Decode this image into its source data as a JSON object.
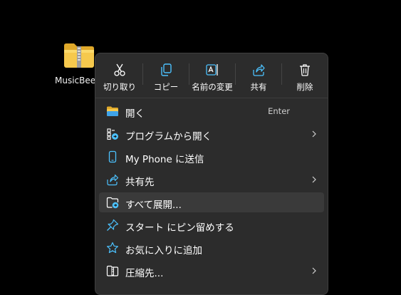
{
  "desktop": {
    "file_label": "MusicBeeS"
  },
  "context_menu": {
    "quick_actions": [
      {
        "label": "切り取り",
        "icon": "scissors-icon"
      },
      {
        "label": "コピー",
        "icon": "copy-icon"
      },
      {
        "label": "名前の変更",
        "icon": "rename-icon"
      },
      {
        "label": "共有",
        "icon": "share-icon"
      },
      {
        "label": "削除",
        "icon": "trash-icon"
      }
    ],
    "items": [
      {
        "label": "開く",
        "shortcut": "Enter",
        "icon": "folder-open-icon"
      },
      {
        "label": "プログラムから開く",
        "icon": "open-with-icon",
        "submenu": true
      },
      {
        "label": "My Phone に送信",
        "icon": "phone-icon"
      },
      {
        "label": "共有先",
        "icon": "share-icon",
        "submenu": true
      },
      {
        "label": "すべて展開...",
        "icon": "extract-icon",
        "highlighted": true
      },
      {
        "label": "スタート にピン留めする",
        "icon": "pin-icon"
      },
      {
        "label": "お気に入りに追加",
        "icon": "star-icon"
      },
      {
        "label": "圧縮先...",
        "icon": "compress-icon",
        "submenu": true
      }
    ]
  },
  "colors": {
    "desktop_bg": "#000000",
    "menu_bg": "#2c2c2c",
    "hover_bg": "#3a3a3a",
    "accent": "#4cc2ff"
  }
}
